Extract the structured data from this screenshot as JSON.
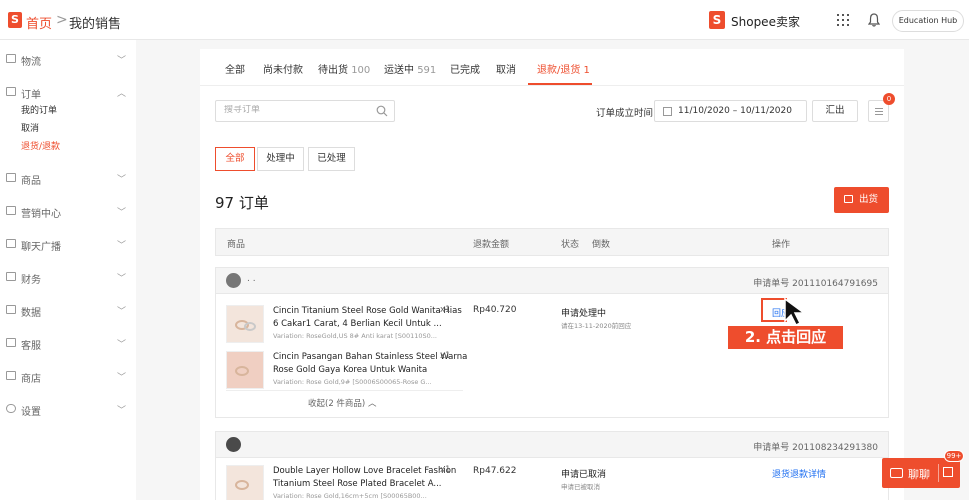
{
  "topbar": {
    "logo_glyph": "S",
    "home": "首页",
    "separator": ">",
    "crumb": "我的销售",
    "brand_logo_glyph": "S",
    "brand": "Shopee卖家",
    "hub": "Education Hub"
  },
  "sidebar": {
    "logistics": "物流",
    "orders": "订单",
    "my_sales": "我的订单",
    "cancel": "取消",
    "returns": "退货/退款",
    "products": "商品",
    "marketing": "营销中心",
    "chat": "聊天广播",
    "finance": "财务",
    "data": "数据",
    "service": "客服",
    "shop": "商店",
    "settings": "设置"
  },
  "tabs": [
    {
      "label": "全部",
      "count": ""
    },
    {
      "label": "尚未付款",
      "count": ""
    },
    {
      "label": "待出货",
      "count": "100"
    },
    {
      "label": "运送中",
      "count": "591"
    },
    {
      "label": "已完成",
      "count": ""
    },
    {
      "label": "取消",
      "count": ""
    },
    {
      "label": "退款/退货 1",
      "count": ""
    }
  ],
  "search": {
    "placeholder": "搜寻订单"
  },
  "date": {
    "label": "订单成立时间",
    "value": "11/10/2020 – 10/11/2020"
  },
  "export_label": "汇出",
  "list_badge": "0",
  "subtabs": [
    "全部",
    "处理中",
    "已处理"
  ],
  "order_count": "97 订单",
  "ship_label": "出货",
  "table_header": {
    "product": "商品",
    "amount": "退款金额",
    "status": "状态",
    "countdown": "倒数",
    "action": "操作"
  },
  "orders": [
    {
      "buyer": ". .",
      "request_no": "申请单号 201110164791695",
      "amount": "Rp40.720",
      "status": "申请处理中",
      "status_sub": "请在13-11-2020前回应",
      "action": "回应",
      "collapse": "收起(2 件商品)",
      "items": [
        {
          "name": "Cincin Titanium Steel Rose Gold Wanita Hias 6 Cakar1 Carat, 4 Berlian Kecil Untuk ...",
          "variation": "Variation: RoseGold,US 8# Anti karat [S00110S0...",
          "qty": "x1"
        },
        {
          "name": "Cincin Pasangan Bahan Stainless Steel Warna Rose Gold Gaya Korea Untuk Wanita",
          "variation": "Variation: Rose Gold,9# [S0006S00065-Rose G...",
          "qty": "x1"
        }
      ]
    },
    {
      "buyer": "",
      "request_no": "申请单号 201108234291380",
      "amount": "Rp47.622",
      "status": "申请已取消",
      "status_sub": "申请已被取消",
      "action": "退货退款详情",
      "items": [
        {
          "name": "Double Layer Hollow Love Bracelet Fashion Titanium Steel Rose Plated Bracelet A...",
          "variation": "Variation: Rose Gold,16cm+5cm [S00065B00...",
          "qty": "x1"
        }
      ]
    }
  ],
  "annotation": "2. 点击回应",
  "chat_widget": {
    "label": "聊聊",
    "badge": "99+"
  },
  "colors": {
    "accent": "#ee4d2d",
    "link": "#1f6ff1"
  }
}
